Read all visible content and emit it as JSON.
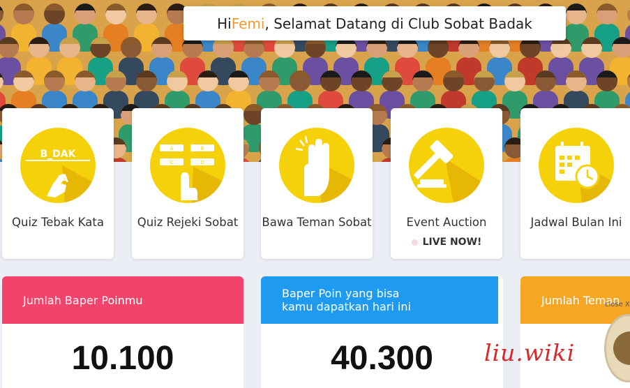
{
  "greeting": {
    "prefix": "Hi ",
    "name": "Femi",
    "suffix": ", Selamat Datang di Club Sobat Badak"
  },
  "menu": [
    {
      "label": "Quiz Tebak Kata",
      "icon": "word-quiz-icon"
    },
    {
      "label": "Quiz Rejeki Sobat",
      "icon": "answer-choices-icon"
    },
    {
      "label": "Bawa Teman Sobat",
      "icon": "hands-raised-icon"
    },
    {
      "label": "Event Auction",
      "icon": "gavel-icon",
      "badge": "LIVE NOW!"
    },
    {
      "label": "Jadwal Bulan Ini",
      "icon": "calendar-clock-icon"
    }
  ],
  "quiz_letters": "B_DAK",
  "quiz_hand_letter": "A",
  "choice_letters": [
    "A",
    "B",
    "C",
    "D"
  ],
  "stats": [
    {
      "title": "Jumlah Baper Poinmu",
      "value": "10.100",
      "color": "#f2436b"
    },
    {
      "title": "Baper Poin yang bisa kamu dapatkan hari ini",
      "value": "40.300",
      "color": "#1e9bf0"
    },
    {
      "title": "Jumlah Teman",
      "value": "",
      "color": "#f6a623"
    }
  ],
  "popup": {
    "close_label": "close X"
  },
  "watermark": "liu.wiki",
  "colors": {
    "accent_orange": "#f29a2e",
    "icon_yellow": "#f5d10a"
  }
}
